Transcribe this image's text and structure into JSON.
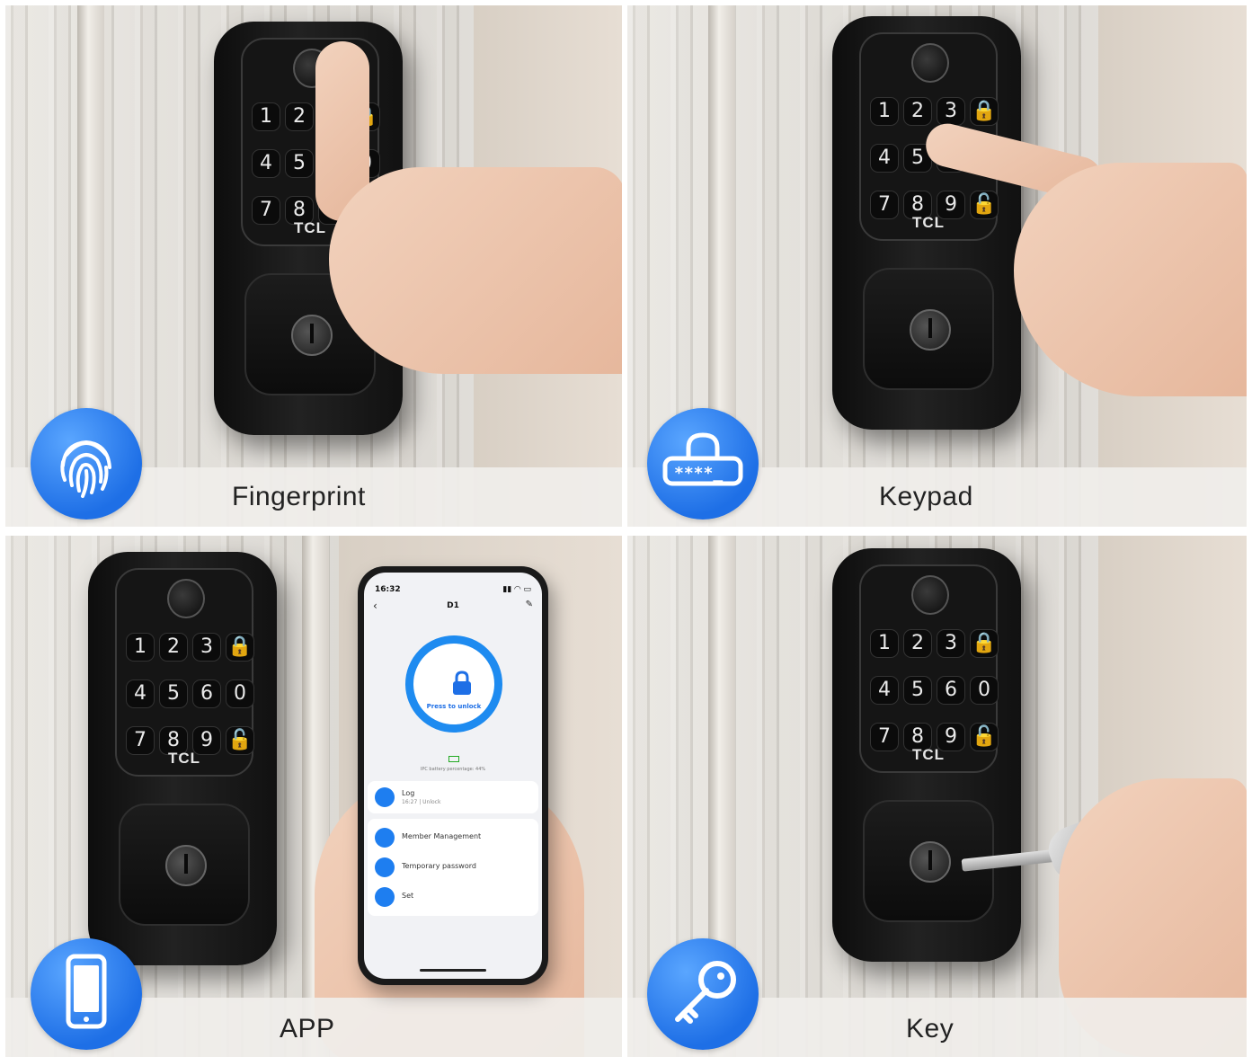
{
  "panels": {
    "fingerprint": {
      "label": "Fingerprint",
      "badge_icon": "fingerprint-icon"
    },
    "keypad": {
      "label": "Keypad",
      "badge_icon": "password-lock-icon"
    },
    "app": {
      "label": "APP",
      "badge_icon": "smartphone-icon"
    },
    "key": {
      "label": "Key",
      "badge_icon": "key-icon"
    }
  },
  "lock": {
    "brand": "TCL",
    "keys": [
      "1",
      "2",
      "3",
      "🔒",
      "4",
      "5",
      "6",
      "0",
      "7",
      "8",
      "9",
      "🔓"
    ]
  },
  "phone": {
    "time": "16:32",
    "title": "D1",
    "unlock_label": "Press to unlock",
    "battery_text": "IPC battery percentage: 44%",
    "log_title": "Log",
    "log_sub": "16:27 | Unlock",
    "menu": [
      "Member Management",
      "Temporary password",
      "Set"
    ]
  },
  "colors": {
    "badge": "#1e6fe6",
    "accent": "#1e8bf0"
  }
}
